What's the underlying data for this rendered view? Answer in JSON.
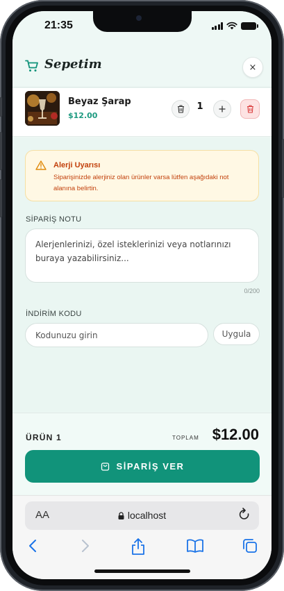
{
  "status_bar": {
    "time": "21:35"
  },
  "header": {
    "title": "Sepetim",
    "cart_icon": "cart-icon",
    "close_label": "×"
  },
  "cart": {
    "items": [
      {
        "name": "Beyaz Şarap",
        "price": "$12.00",
        "quantity": "1"
      }
    ]
  },
  "allergy_alert": {
    "title": "Alerji Uyarısı",
    "text": "Siparişinizde alerjiniz olan ürünler varsa lütfen aşağıdaki not alanına belirtin."
  },
  "order_note": {
    "label": "SİPARİŞ NOTU",
    "placeholder": "Alerjenlerinizi, özel isteklerinizi veya notlarınızı buraya yazabilirsiniz...",
    "counter": "0/200"
  },
  "discount": {
    "label": "İNDİRİM KODU",
    "placeholder": "Kodunuzu girin",
    "apply_label": "Uygula"
  },
  "footer": {
    "item_count_label": "ÜRÜN 1",
    "total_label": "TOPLAM",
    "total_value": "$12.00",
    "order_button_label": "SİPARİŞ VER"
  },
  "browser": {
    "aa_label": "AA",
    "url": "localhost"
  },
  "colors": {
    "accent": "#11937a",
    "price": "#1d9a80",
    "alert_text": "#c2410c",
    "alert_bg": "#fff8e4"
  }
}
